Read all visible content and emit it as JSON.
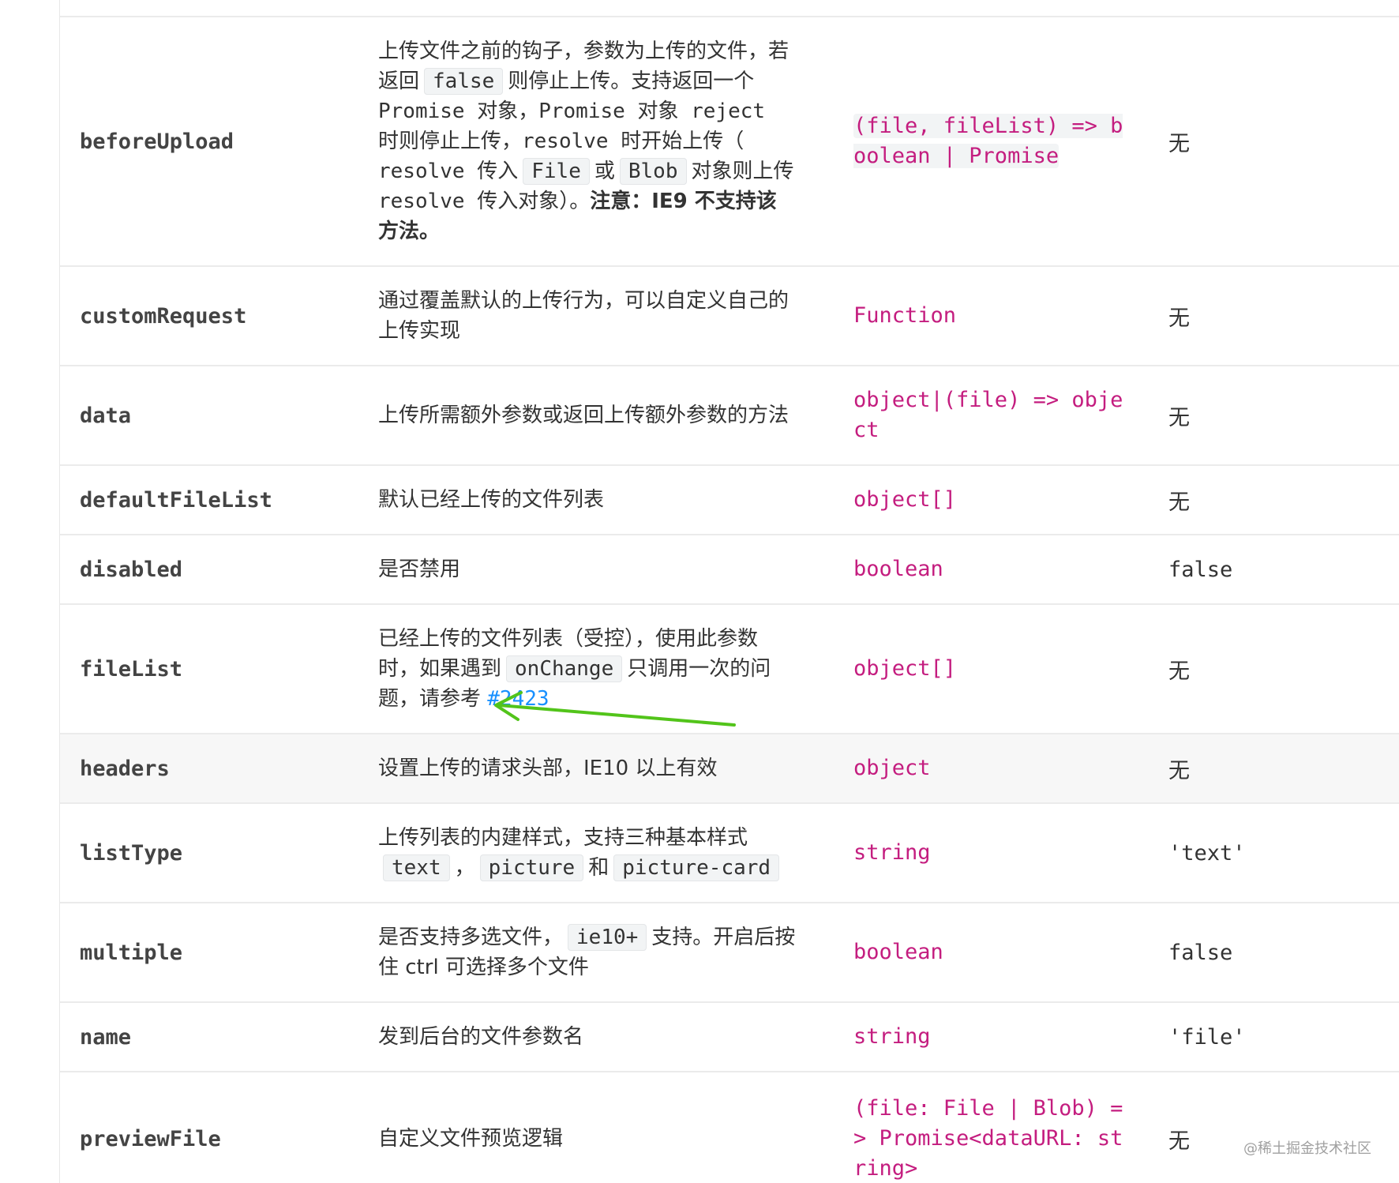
{
  "rows": {
    "beforeUpload": {
      "name": "beforeUpload",
      "desc": {
        "t1": "上传文件之前的钩子，参数为上传的文件，若返回",
        "c1": "false",
        "t2": "则停止上传。支持返回一个",
        "t3": "Promise 对象，Promise 对象 reject 时则停止上传，resolve 时开始上传（ resolve 传入",
        "c2": "File",
        "t4": "或",
        "c3": "Blob",
        "t5": "对象则上传 resolve 传入对象）。",
        "note": "注意：IE9 不支持该方法。"
      },
      "type": "(file, fileList) => boolean | Promise",
      "default": "无"
    },
    "customRequest": {
      "name": "customRequest",
      "desc": "通过覆盖默认的上传行为，可以自定义自己的上传实现",
      "type": "Function",
      "default": "无"
    },
    "data": {
      "name": "data",
      "desc": "上传所需额外参数或返回上传额外参数的方法",
      "type": "object|(file) => object",
      "default": "无"
    },
    "defaultFileList": {
      "name": "defaultFileList",
      "desc": "默认已经上传的文件列表",
      "type": "object[]",
      "default": "无"
    },
    "disabled": {
      "name": "disabled",
      "desc": "是否禁用",
      "type": "boolean",
      "default": "false"
    },
    "fileList": {
      "name": "fileList",
      "desc": {
        "t1": "已经上传的文件列表（受控），使用此参数时，如果遇到",
        "c1": "onChange",
        "t2": "只调用一次的问题，请参考",
        "link": "#2423"
      },
      "type": "object[]",
      "default": "无"
    },
    "headers": {
      "name": "headers",
      "desc": "设置上传的请求头部，IE10 以上有效",
      "type": "object",
      "default": "无"
    },
    "listType": {
      "name": "listType",
      "desc": {
        "t1": "上传列表的内建样式，支持三种基本样式",
        "c1": "text",
        "sep": "，",
        "c2": "picture",
        "and": "和",
        "c3": "picture-card"
      },
      "type": "string",
      "default": "'text'"
    },
    "multiple": {
      "name": "multiple",
      "desc": {
        "t1": "是否支持多选文件，",
        "c1": "ie10+",
        "t2": "支持。开启后按住 ctrl 可选择多个文件"
      },
      "type": "boolean",
      "default": "false"
    },
    "name": {
      "name": "name",
      "desc": "发到后台的文件参数名",
      "type": "string",
      "default": "'file'"
    },
    "previewFile": {
      "name": "previewFile",
      "desc": "自定义文件预览逻辑",
      "type": "(file: File | Blob) => Promise<dataURL: string>",
      "default": "无"
    }
  },
  "watermark": "@稀土掘金技术社区",
  "colors": {
    "type": "#c41d7f",
    "link": "#1890ff",
    "arrow": "#52c41a"
  }
}
